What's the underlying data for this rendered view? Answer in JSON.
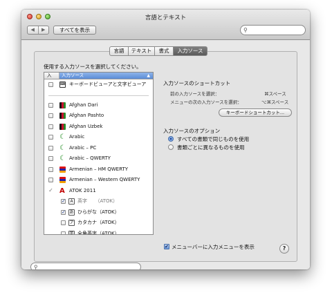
{
  "window": {
    "title": "言語とテキスト"
  },
  "toolbar": {
    "back_glyph": "◀",
    "forward_glyph": "▶",
    "show_all_label": "すべてを表示",
    "search_placeholder": ""
  },
  "tabs": [
    {
      "label": "言語",
      "selected": false
    },
    {
      "label": "テキスト",
      "selected": false
    },
    {
      "label": "書式",
      "selected": false
    },
    {
      "label": "入力ソース",
      "selected": true
    }
  ],
  "instruction": "使用する入力ソースを選択してください。",
  "list": {
    "col_enabled": "入",
    "col_source": "入力ソース",
    "sort_glyph": "▲",
    "rows": [
      {
        "label": "キーボードビューアと文字ビューア",
        "checked": false,
        "icon": "keyboard-viewer-icon"
      },
      {
        "divider": true
      },
      {
        "label": "Afghan Dari",
        "checked": false,
        "icon": "afghan-flag-icon"
      },
      {
        "label": "Afghan Pashto",
        "checked": false,
        "icon": "afghan-flag-icon"
      },
      {
        "label": "Afghan Uzbek",
        "checked": false,
        "icon": "afghan-flag-icon"
      },
      {
        "label": "Arabic",
        "checked": false,
        "icon": "arabic-crescent-icon"
      },
      {
        "label": "Arabic – PC",
        "checked": false,
        "icon": "arabic-crescent-icon"
      },
      {
        "label": "Arabic – QWERTY",
        "checked": false,
        "icon": "arabic-crescent-icon"
      },
      {
        "label": "Armenian – HM QWERTY",
        "checked": false,
        "icon": "armenian-flag-icon"
      },
      {
        "label": "Armenian – Western QWERTY",
        "checked": false,
        "icon": "armenian-flag-icon"
      },
      {
        "label": "ATOK 2011",
        "checked": true,
        "icon": "atok-icon",
        "group": true
      },
      {
        "label": "英字 　 （ATOK）",
        "checked": true,
        "sub": true,
        "dim": true,
        "icon_char": "A"
      },
      {
        "label": "ひらがな（ATOK）",
        "checked": true,
        "sub": true,
        "icon_char": "あ"
      },
      {
        "label": "カタカナ（ATOK）",
        "checked": false,
        "sub": true,
        "icon_char": "ア"
      },
      {
        "label": "全角英字（ATOK）",
        "checked": false,
        "sub": true,
        "icon_char": "英"
      }
    ]
  },
  "shortcuts": {
    "heading": "入力ソースのショートカット",
    "prev_label": "前の入力ソースを選択：",
    "prev_key": "⌘スペース",
    "next_label": "メニューの次の入力ソースを選択：",
    "next_key": "⌥⌘スペース",
    "button": "キーボードショートカット..."
  },
  "options": {
    "heading": "入力ソースのオプション",
    "radio1": "すべての書類で同じものを使用",
    "radio2": "書類ごとに異なるものを使用",
    "selected": 1
  },
  "bottom": {
    "search_placeholder": "",
    "menu_checkbox_label": "メニューバーに入力メニューを表示",
    "menu_checked": true,
    "help_glyph": "?"
  }
}
